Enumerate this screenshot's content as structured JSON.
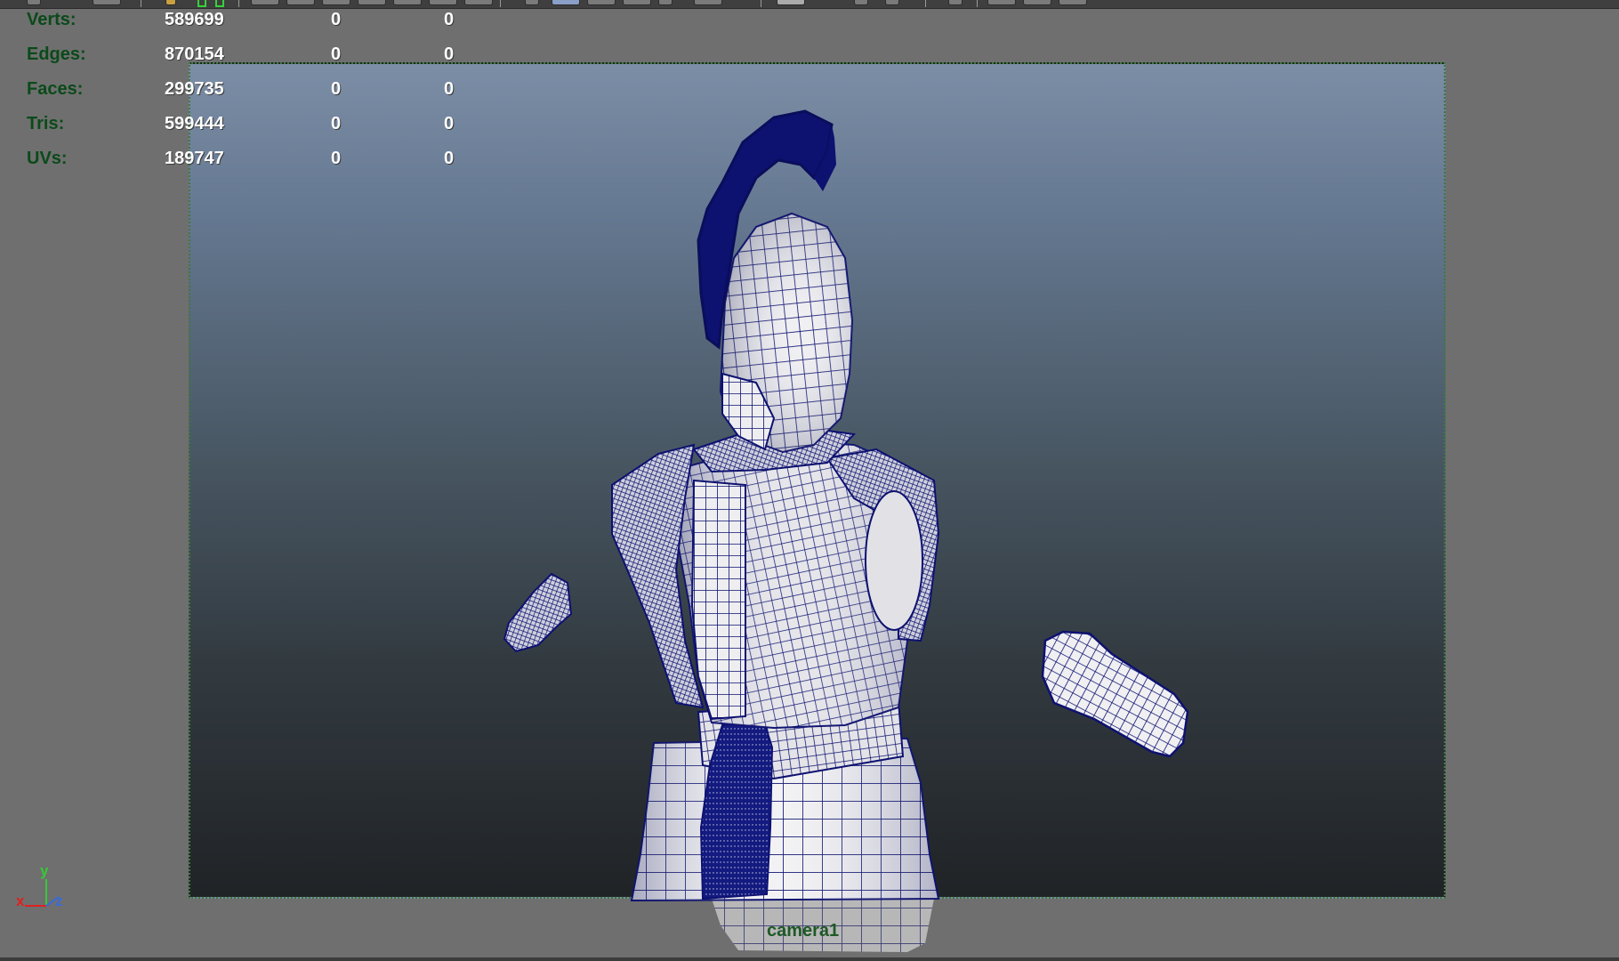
{
  "hud": {
    "rows": [
      {
        "label": "Verts:",
        "v1": "589699",
        "v2": "0",
        "v3": "0"
      },
      {
        "label": "Edges:",
        "v1": "870154",
        "v2": "0",
        "v3": "0"
      },
      {
        "label": "Faces:",
        "v1": "299735",
        "v2": "0",
        "v3": "0"
      },
      {
        "label": "Tris:",
        "v1": "599444",
        "v2": "0",
        "v3": "0"
      },
      {
        "label": "UVs:",
        "v1": "189747",
        "v2": "0",
        "v3": "0"
      }
    ]
  },
  "viewport": {
    "camera_name": "camera1",
    "axis": {
      "x": "x",
      "y": "y",
      "z": "z"
    }
  },
  "colors": {
    "viewport_bg": "#6f6f6f",
    "hud_label": "#0b4a1a",
    "hud_value": "#ffffff",
    "gate_border": "#3d7a3d",
    "wireframe": "#0d1170",
    "surface": "#e9e9ec",
    "axis_x": "#e02020",
    "axis_y": "#38c838",
    "axis_z": "#3a6bd8"
  },
  "icons": [
    "axis-gizmo-icon",
    "toolbar-button-icon"
  ]
}
